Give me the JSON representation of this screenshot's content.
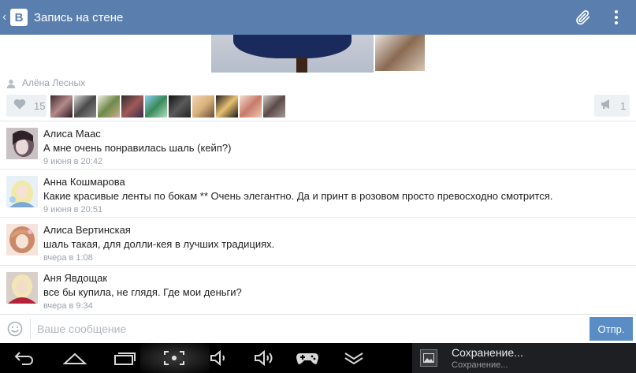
{
  "header": {
    "title": "Запись на стене",
    "logo": "В",
    "back_icon": "chevron-left-icon",
    "attach_icon": "paperclip-icon",
    "menu_icon": "more-vertical-icon"
  },
  "post": {
    "author": "Алёна Лесных",
    "likes_count": "15",
    "reposts_count": "1",
    "liker_avatar_count": 10
  },
  "comments": [
    {
      "author": "Алиса Маас",
      "text": "А мне очень понравилась шаль (кейп?)",
      "time": "9 июня в 20:42"
    },
    {
      "author": "Анна Кошмарова",
      "text": "Какие красивые ленты по бокам ** Очень элегантно. Да и принт в розовом просто превосходно смотрится.",
      "time": "9 июня в 20:51"
    },
    {
      "author": "Алиса Вертинская",
      "text": "шаль такая, для долли-кея в лучших традициях.",
      "time": "вчера в 1:08"
    },
    {
      "author": "Аня Явдощак",
      "text": "все бы купила, не глядя. Где мои деньги?",
      "time": "вчера в 9:34"
    }
  ],
  "message_bar": {
    "placeholder": "Ваше сообщение",
    "value": "",
    "send_label": "Отпр."
  },
  "notification": {
    "title": "Сохранение...",
    "subtitle": "Сохранение..."
  },
  "colors": {
    "header_bg": "#5a7fae",
    "send_button": "#5a8dc6",
    "meta_text": "#9aa3ad"
  }
}
